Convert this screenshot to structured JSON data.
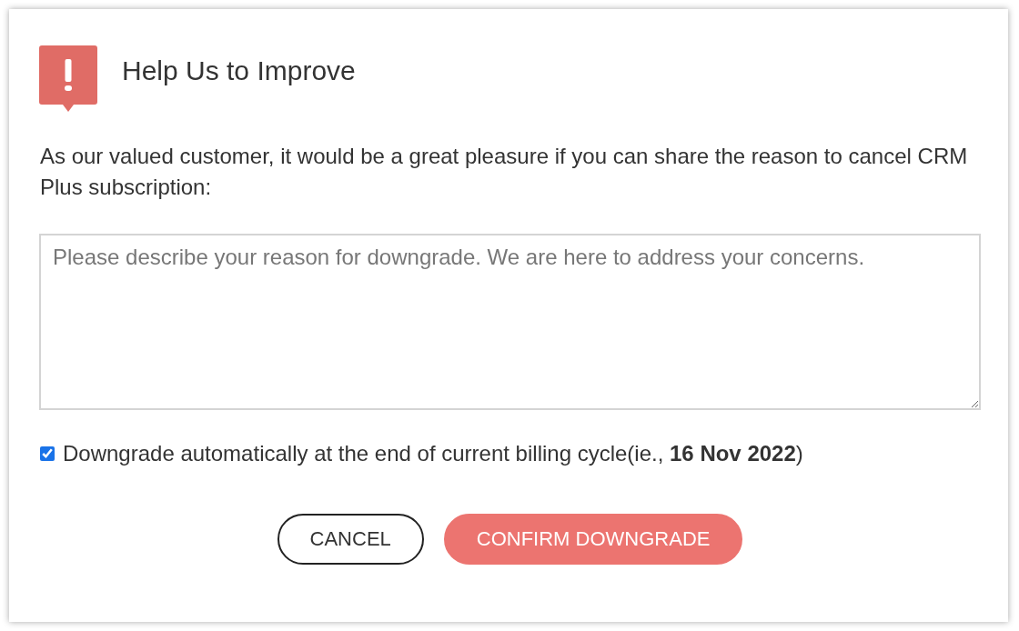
{
  "dialog": {
    "title": "Help Us to Improve",
    "message": "As our valued customer, it would be a great pleasure if you can share the reason to cancel CRM Plus subscription:",
    "reason_field": {
      "placeholder": "Please describe your reason for downgrade. We are here to address your concerns."
    },
    "auto_downgrade": {
      "label": "Downgrade automatically at the end of current billing cycle(ie., **16 Nov 2022**)",
      "checked": true
    },
    "buttons": [
      {
        "label": "CANCEL",
        "kind": "secondary"
      },
      {
        "label": "CONFIRM DOWNGRADE",
        "kind": "primary"
      }
    ]
  }
}
